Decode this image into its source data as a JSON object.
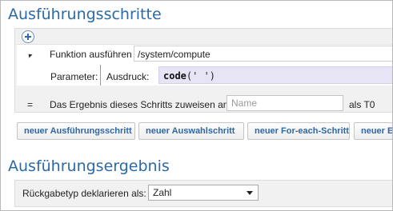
{
  "sections": {
    "execution_steps_title": "Ausführungsschritte",
    "execution_result_title": "Ausführungsergebnis"
  },
  "step": {
    "function_label": "Funktion ausführen",
    "function_value": "/system/compute",
    "parameter_label": "Parameter:",
    "expression_label": "Ausdruck:",
    "expression_keyword": "code",
    "expression_args": "(' ')",
    "equals_sign": "=",
    "assign_label": "Das Ergebnis dieses Schritts zuweisen an",
    "name_placeholder": "Name",
    "name_value": "",
    "as_label": "als T0"
  },
  "buttons": {
    "new_execution_step": "neuer Ausführungsschritt",
    "new_choice_step": "neuer Auswahlschritt",
    "new_for_each_step": "neuer For-each-Schritt",
    "new_truncated": "neuer E"
  },
  "result": {
    "return_type_label": "Rückgabetyp deklarieren als:",
    "return_type_value": "Zahl"
  },
  "icons": {
    "add": "plus-icon",
    "collapse": "collapse-arrow-icon",
    "dropdown": "chevron-down-icon"
  },
  "colors": {
    "title": "#2b6aa8",
    "button_text": "#2e67a8",
    "expression_bg": "#e7e4f6",
    "panel_bg": "#f1f1f1"
  }
}
